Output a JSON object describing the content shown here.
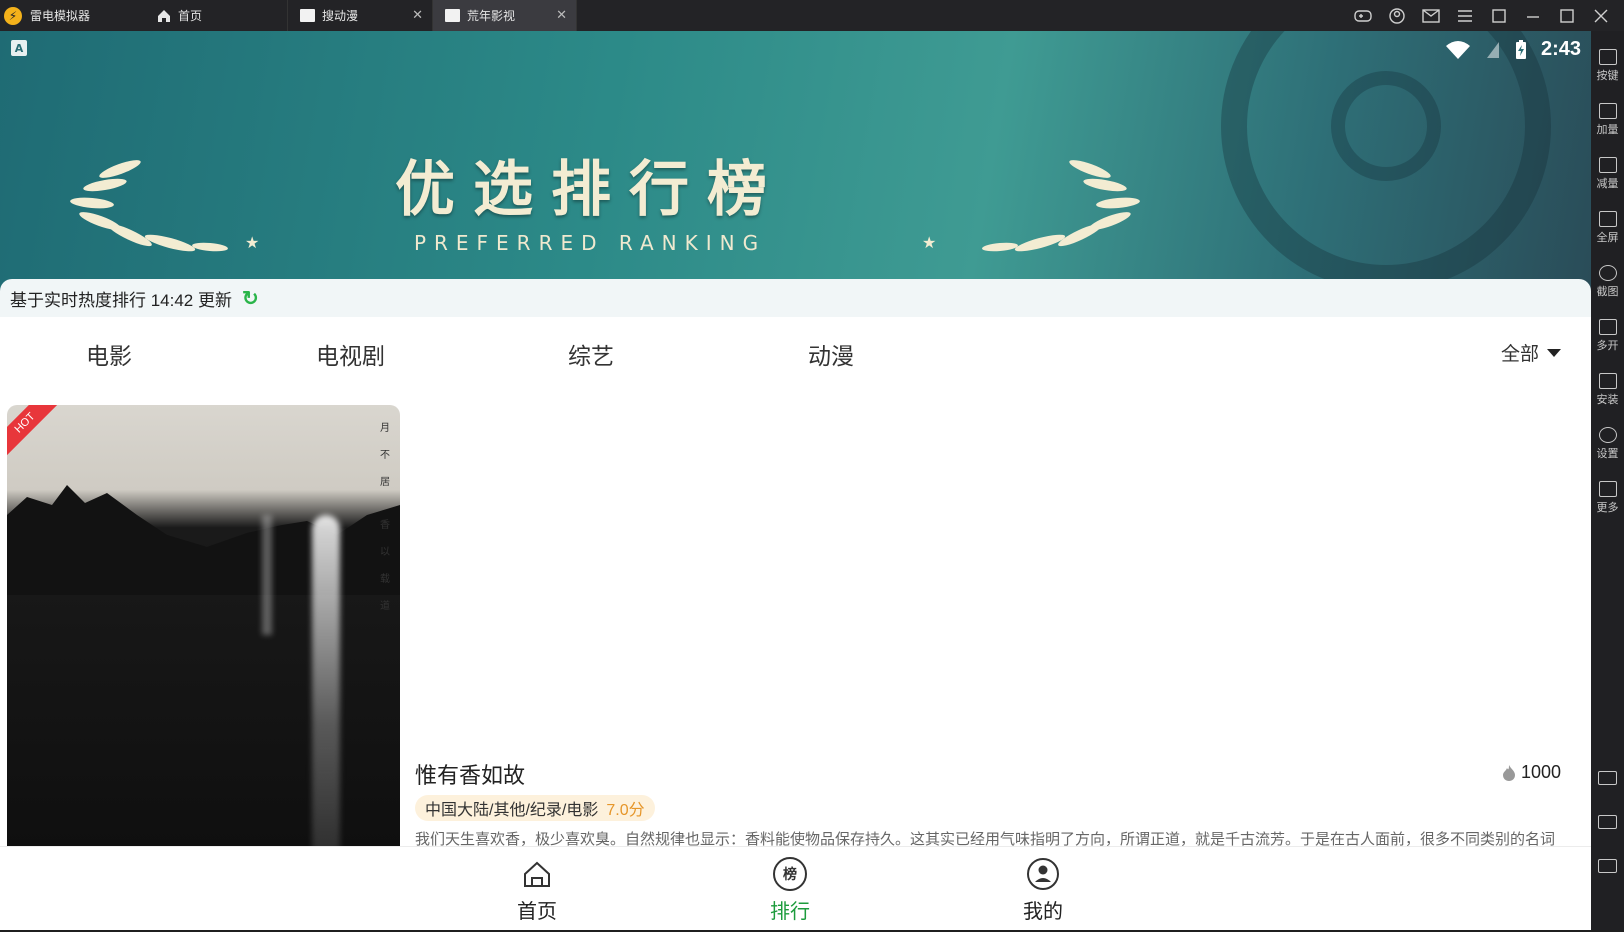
{
  "emulator": {
    "app_name": "雷电模拟器",
    "tabs": [
      {
        "label": "首页"
      },
      {
        "label": "搜动漫"
      },
      {
        "label": "荒年影视"
      }
    ],
    "sidebar": [
      "按键",
      "加量",
      "减量",
      "全屏",
      "截图",
      "多开",
      "安装",
      "设置",
      "更多"
    ]
  },
  "status": {
    "time": "2:43"
  },
  "banner": {
    "title": "优选排行榜",
    "subtitle": "PREFERRED RANKING"
  },
  "update_line": {
    "text": "基于实时热度排行 14:42 更新"
  },
  "categories": [
    "电影",
    "电视剧",
    "综艺",
    "动漫"
  ],
  "filter": {
    "label": "全部"
  },
  "item": {
    "hot_badge": "HOT",
    "poster_text": [
      "月",
      "不",
      "居",
      "香",
      "以",
      "载",
      "道"
    ],
    "title": "惟有香如故",
    "heat": "1000",
    "tags": "中国大陆/其他/纪录/电影",
    "score": "7.0分",
    "description": "我们天生喜欢香，极少喜欢臭。自然规律也显示：香料能使物品保存持久。这其实已经用气味指明了方向，所谓正道，就是千古流芳。于是在古人面前，很多不同类别的名词"
  },
  "bottom_nav": [
    {
      "label": "首页",
      "icon": "home-icon"
    },
    {
      "label": "排行",
      "icon": "ranking-icon",
      "active": true,
      "icon_text": "榜"
    },
    {
      "label": "我的",
      "icon": "profile-icon"
    }
  ],
  "colors": {
    "accent": "#1c9b3c",
    "hot": "#e8363b",
    "score": "#e6962a"
  }
}
